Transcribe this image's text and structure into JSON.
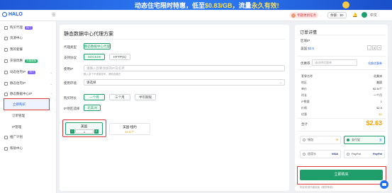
{
  "banner": {
    "text_main": "动态住宅限时特惠，低至",
    "price": "$0.83/GB",
    "text_mid": "，流量",
    "highlight": "永久有效!"
  },
  "topbar": {
    "logo": "HALO",
    "collapse": "☰",
    "user_tag": "专题更新任务",
    "balance": "余额：$0",
    "lang": "中文"
  },
  "sidebar": {
    "items": [
      {
        "label": "购买代理",
        "tag": "热门"
      },
      {
        "label": "资源中心"
      },
      {
        "label": "我的套餐"
      },
      {
        "label": "充值优惠",
        "hot": "充值奖励"
      },
      {
        "label": "动态住宅IP",
        "tag": "热门"
      },
      {
        "label": "静态住宅IP"
      },
      {
        "label": "静态数据中心IP"
      },
      {
        "label": "订单管理"
      },
      {
        "label": "IP管理"
      },
      {
        "label": "推广计划"
      },
      {
        "label": "帮助中心"
      }
    ],
    "active": "立即购买",
    "subs": [
      "订单管理",
      "IP管理"
    ]
  },
  "main": {
    "title": "静态数据中心代理方案",
    "proxy_type_label": "代理类型",
    "proxy_type_value": "静态数据中心代理",
    "protocol_label": "支持协议",
    "protocols": [
      "SOCKS5",
      "HTTP(S)"
    ],
    "whitelist_label": "使用IP",
    "whitelist_placeholder": "请输入您要添加的IP白名单",
    "whitelist_hint": "输入多个IP请用逗号，请检查格式",
    "usage_label": "使用环境",
    "usage_value": "请选择",
    "period_label": "购买时长",
    "periods": [
      "一个月",
      "三个月",
      "半年期限"
    ],
    "region_label": "IP地区选择",
    "region_value": "北美洲",
    "card_a": {
      "name": "美国",
      "qty": "1",
      "minus": "-",
      "plus": "+"
    },
    "card_b": {
      "name": "美国-纽约",
      "price": "$2.5/个"
    }
  },
  "order": {
    "title": "订单详情",
    "region_label": "区域IP",
    "region_name": "美国",
    "region_sub": "$2.5",
    "qty": "1",
    "coupon_label": "优惠券",
    "coupon_placeholder": "请选择优惠券",
    "coupon_action": "兑换优惠券",
    "rows": [
      {
        "label": "套餐名称",
        "value": "北美洲"
      },
      {
        "label": "地区",
        "value": "美国"
      },
      {
        "label": "单价",
        "value": "$2.5/个"
      },
      {
        "label": "时长",
        "value": "一个月"
      },
      {
        "label": "IP数量",
        "value": "1"
      },
      {
        "label": "价格",
        "value": "$2.5"
      },
      {
        "label": "优惠",
        "value": "-$0"
      }
    ],
    "total_label": "合计",
    "total": "$2.63",
    "payments": [
      "钱包",
      "支付宝",
      "信用卡",
      "PayPal"
    ],
    "pay_icons": [
      "wallet-icon",
      "alipay-icon",
      "visa-icon",
      "paypal-icon"
    ],
    "pay_marks": [
      "⊞",
      "支",
      "VISA",
      "PayPal"
    ],
    "buy_label": "立即购买",
    "note": "购买前请仔细阅读《服务条款》"
  }
}
